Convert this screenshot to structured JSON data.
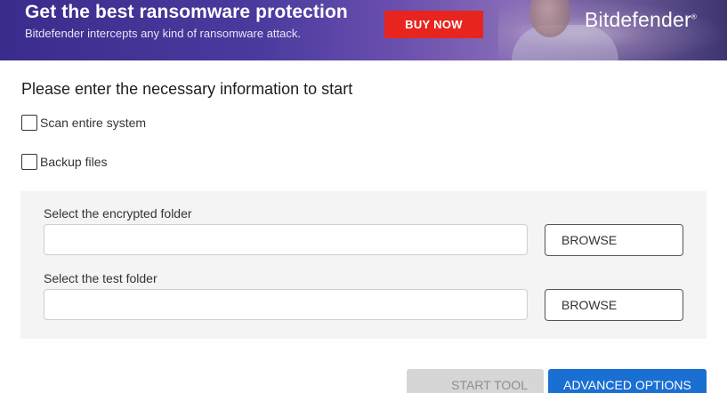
{
  "banner": {
    "title": "Get the best ransomware protection",
    "subtitle": "Bitdefender intercepts any kind of ransomware attack.",
    "buy_label": "BUY NOW",
    "brand": "Bitdefender",
    "brand_mark": "®",
    "colors": {
      "buy": "#e8241e",
      "background": "#4a3a9e"
    }
  },
  "form": {
    "instruction": "Please enter the necessary information to start",
    "options": [
      {
        "label": "Scan entire system",
        "checked": false
      },
      {
        "label": "Backup files",
        "checked": false
      }
    ],
    "fields": [
      {
        "label": "Select the encrypted folder",
        "value": "",
        "placeholder": "",
        "browse_label": "BROWSE"
      },
      {
        "label": "Select the test folder",
        "value": "",
        "placeholder": "",
        "browse_label": "BROWSE"
      }
    ]
  },
  "actions": {
    "start_label": "START TOOL",
    "start_enabled": false,
    "advanced_label": "ADVANCED OPTIONS",
    "colors": {
      "advanced": "#1a6fd2",
      "start_disabled": "#d6d6d6"
    }
  }
}
